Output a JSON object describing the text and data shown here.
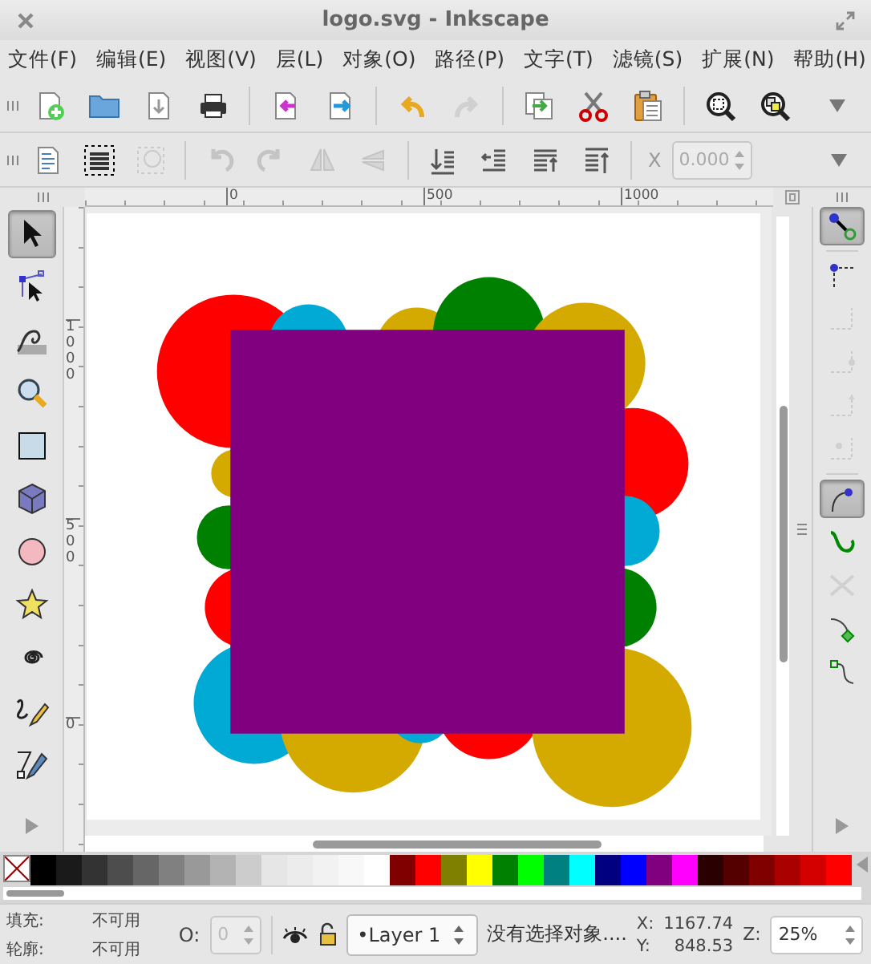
{
  "window": {
    "title": "logo.svg - Inkscape"
  },
  "menu": [
    "文件(F)",
    "编辑(E)",
    "视图(V)",
    "层(L)",
    "对象(O)",
    "路径(P)",
    "文字(T)",
    "滤镜(S)",
    "扩展(N)",
    "帮助(H)"
  ],
  "main_toolbar": {
    "buttons": [
      {
        "disabled": false
      },
      {
        "disabled": false
      },
      {
        "disabled": false
      },
      {
        "disabled": false
      },
      {
        "disabled": false
      },
      {
        "disabled": false
      },
      {
        "disabled": false
      },
      {
        "disabled": true
      },
      {
        "disabled": false
      },
      {
        "disabled": false
      },
      {
        "disabled": false
      },
      {
        "disabled": false
      },
      {
        "disabled": false
      }
    ]
  },
  "command_toolbar": {
    "buttons": [
      {
        "disabled": false
      },
      {
        "disabled": false
      },
      {
        "disabled": true
      },
      {
        "disabled": true
      },
      {
        "disabled": true
      },
      {
        "disabled": true
      },
      {
        "disabled": true
      },
      {
        "disabled": false
      },
      {
        "disabled": false
      },
      {
        "disabled": false
      },
      {
        "disabled": false
      }
    ],
    "x_field": {
      "label": "X",
      "value": "0.000",
      "disabled": true
    }
  },
  "top_ruler": [
    "0",
    "500",
    "1000"
  ],
  "side_ruler": [
    "1000",
    "500",
    "0"
  ],
  "tools": [
    {
      "selected": true
    },
    {
      "selected": false
    },
    {
      "selected": false
    },
    {
      "selected": false
    },
    {
      "selected": false
    },
    {
      "selected": false
    },
    {
      "selected": false
    },
    {
      "selected": false
    },
    {
      "selected": false
    },
    {
      "selected": false
    },
    {
      "selected": false
    }
  ],
  "snap_toolbar": [
    {
      "on": true,
      "disabled": false
    },
    {
      "on": false,
      "disabled": false
    },
    {
      "on": false,
      "disabled": true
    },
    {
      "on": false,
      "disabled": true
    },
    {
      "on": false,
      "disabled": true
    },
    {
      "on": false,
      "disabled": true
    },
    {
      "on": true,
      "disabled": false
    },
    {
      "on": false,
      "disabled": false
    },
    {
      "on": false,
      "disabled": true
    },
    {
      "on": false,
      "disabled": false
    },
    {
      "on": false,
      "disabled": false
    }
  ],
  "palette": {
    "swatches": [
      {
        "color": "#000000"
      },
      {
        "color": "#1a1a1a"
      },
      {
        "color": "#333333"
      },
      {
        "color": "#4d4d4d"
      },
      {
        "color": "#666666"
      },
      {
        "color": "#808080"
      },
      {
        "color": "#999999"
      },
      {
        "color": "#b3b3b3"
      },
      {
        "color": "#cccccc"
      },
      {
        "color": "#e6e6e6"
      },
      {
        "color": "#ececec"
      },
      {
        "color": "#f2f2f2"
      },
      {
        "color": "#f8f8f8"
      },
      {
        "color": "#ffffff"
      },
      {
        "color": "#800000"
      },
      {
        "color": "#ff0000"
      },
      {
        "color": "#808000"
      },
      {
        "color": "#ffff00"
      },
      {
        "color": "#008000"
      },
      {
        "color": "#00ff00"
      },
      {
        "color": "#008080"
      },
      {
        "color": "#00ffff"
      },
      {
        "color": "#000080"
      },
      {
        "color": "#0000ff"
      },
      {
        "color": "#800080"
      },
      {
        "color": "#ff00ff"
      },
      {
        "color": "#2b0000"
      },
      {
        "color": "#550000"
      },
      {
        "color": "#800000"
      },
      {
        "color": "#aa0000"
      },
      {
        "color": "#d40000"
      },
      {
        "color": "#ff0000"
      }
    ]
  },
  "status_bar": {
    "fill_label": "填充:",
    "fill_value": "不可用",
    "stroke_label": "轮廓:",
    "stroke_value": "不可用",
    "opacity_label": "O:",
    "opacity_value": "0",
    "opacity_disabled": true,
    "layer": "•Layer 1",
    "message": "没有选择对象....",
    "x_label": "X:",
    "x_value": "1167.74",
    "y_label": "Y:",
    "y_value": "848.53",
    "zoom_label": "Z:",
    "zoom_value": "25%"
  }
}
